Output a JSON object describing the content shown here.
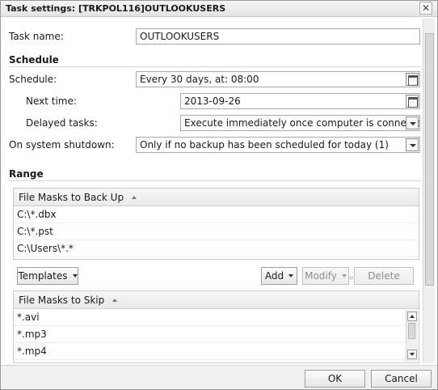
{
  "window": {
    "title": "Task settings: [TRKPOL116]OUTLOOKUSERS",
    "close_glyph": "✕"
  },
  "task": {
    "label": "Task name:",
    "value": "OUTLOOKUSERS"
  },
  "schedule": {
    "section_title": "Schedule",
    "schedule_label": "Schedule:",
    "schedule_value": "Every 30 days, at: 08:00",
    "next_time_label": "Next time:",
    "next_time_value": "2013-09-26",
    "delayed_label": "Delayed tasks:",
    "delayed_value": "Execute immediately once computer is connected",
    "shutdown_label": "On system shutdown:",
    "shutdown_value": "Only if no backup has been scheduled for today (1)"
  },
  "range": {
    "section_title": "Range",
    "backup_header": "File Masks to Back Up",
    "backup_rows": [
      "C:\\*.dbx",
      "C:\\*.pst",
      "C:\\Users\\*.*"
    ],
    "templates_label": "Templates",
    "add_label": "Add",
    "modify_label": "Modify",
    "delete_label": "Delete",
    "skip_header": "File Masks to Skip",
    "skip_rows": [
      "*.avi",
      "*.mp3",
      "*.mp4"
    ]
  },
  "footer": {
    "ok_label": "OK",
    "cancel_label": "Cancel"
  }
}
